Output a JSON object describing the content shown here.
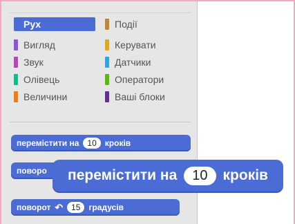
{
  "categories": {
    "left": [
      {
        "label": "Рух",
        "color": "#4a6cd4",
        "selected": true
      },
      {
        "label": "Вигляд",
        "color": "#8a55d7"
      },
      {
        "label": "Звук",
        "color": "#bb42c3"
      },
      {
        "label": "Олівець",
        "color": "#0fbd8c"
      },
      {
        "label": "Величини",
        "color": "#ee7d16"
      }
    ],
    "right": [
      {
        "label": "Події",
        "color": "#c88330"
      },
      {
        "label": "Керувати",
        "color": "#e1a91a"
      },
      {
        "label": "Датчики",
        "color": "#2ca5e2"
      },
      {
        "label": "Оператори",
        "color": "#5cb712"
      },
      {
        "label": "Ваші блоки",
        "color": "#632d99"
      }
    ]
  },
  "blocks": {
    "move": {
      "text": "перемістити на",
      "value": "10",
      "suffix": "кроків"
    },
    "turn_right": {
      "text": "поворо"
    },
    "turn_left": {
      "text": "поворот",
      "icon": "rotate-left-icon",
      "value": "15",
      "suffix": "градусів"
    }
  },
  "zoom_block": {
    "text": "перемістити на",
    "value": "10",
    "suffix": "кроків"
  }
}
